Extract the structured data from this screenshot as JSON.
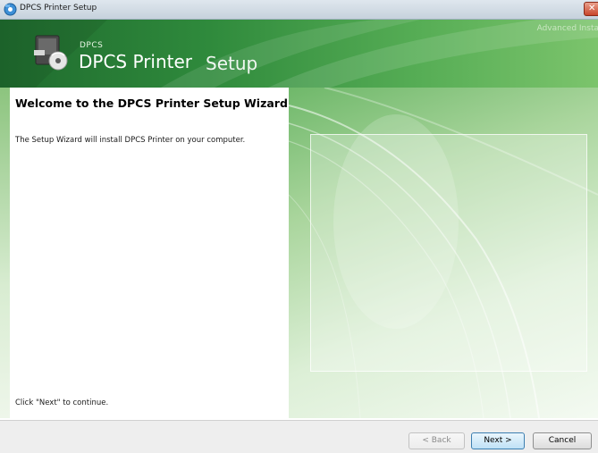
{
  "window": {
    "title": "DPCS Printer Setup",
    "close_glyph": "✕"
  },
  "banner": {
    "small_brand": "DPCS",
    "product_name": "DPCS Printer",
    "setup_word": "Setup",
    "tagline": "Advanced Install"
  },
  "content": {
    "heading": "Welcome to the DPCS Printer Setup Wizard",
    "intro": "The Setup Wizard will install DPCS Printer on your computer.",
    "continue_hint": "Click \"Next\" to continue."
  },
  "buttons": {
    "back": "< Back",
    "next": "Next >",
    "cancel": "Cancel"
  },
  "colors": {
    "banner_dark": "#1f6b2e",
    "banner_light": "#7cc46c",
    "next_button_border": "#3c7fb1"
  },
  "icons": {
    "app": "installer-icon",
    "product": "computer-cd-icon",
    "close": "close-icon"
  }
}
